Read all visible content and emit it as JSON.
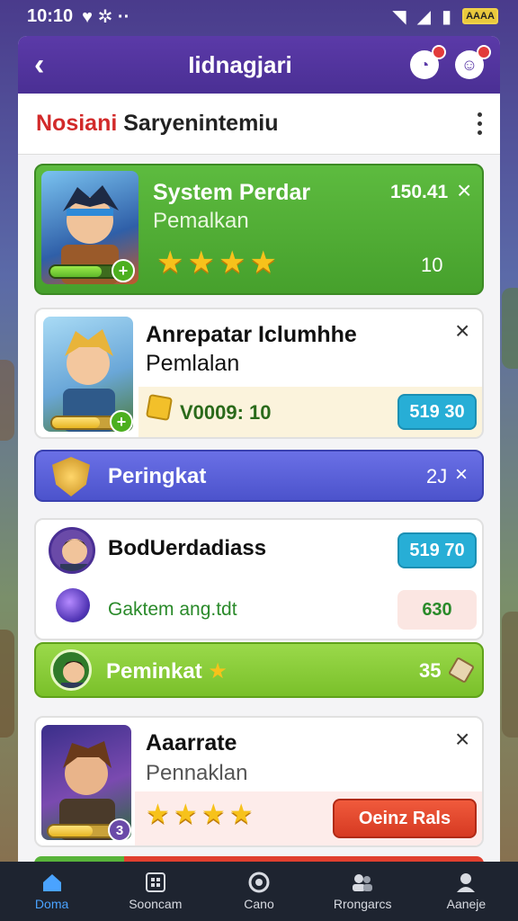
{
  "status": {
    "time": "10:10",
    "battery": "AAAA"
  },
  "appbar": {
    "title": "Iidnagjari"
  },
  "subheader": {
    "title_red": "Nosiani",
    "title_dark": "Saryenintemiu"
  },
  "cards": [
    {
      "title": "System Perdar",
      "subtitle": "Pemalkan",
      "value": "150.41",
      "count": "10",
      "stars": 4
    },
    {
      "title": "Anrepatar Iclumhhe",
      "subtitle": "Pemlalan",
      "label": "V0009: 10",
      "button": "519 30"
    },
    {
      "title": "Peringkat",
      "value": "2J"
    },
    {
      "title": "BodUerdadiass",
      "button": "519 70",
      "label": "Gaktem ang.tdt",
      "badge": "630"
    },
    {
      "title": "Peminkat",
      "value": "35"
    },
    {
      "title": "Aaarrate",
      "subtitle": "Pennaklan",
      "button": "Oeinz Rals",
      "level": "3",
      "stars": 4
    }
  ],
  "nav": [
    {
      "label": "Doma",
      "icon": "home-icon"
    },
    {
      "label": "Sooncam",
      "icon": "grid-icon"
    },
    {
      "label": "Cano",
      "icon": "circle-icon"
    },
    {
      "label": "Rrongarcs",
      "icon": "people-icon"
    },
    {
      "label": "Aaneje",
      "icon": "user-icon"
    }
  ],
  "colors": {
    "primary": "#5b3aa8",
    "green": "#58b43a",
    "blue": "#5b63dd",
    "lime": "#8fd33a",
    "teal": "#27aed6",
    "red": "#e0402f"
  }
}
